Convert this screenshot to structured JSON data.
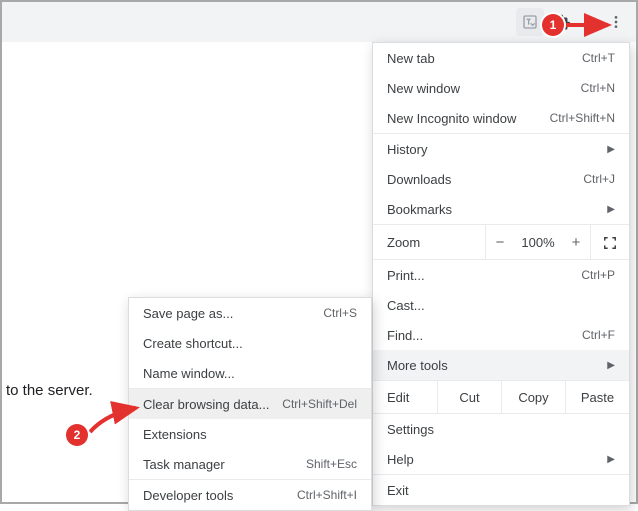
{
  "page_fragment": "to the server.",
  "main_menu": {
    "new_tab": {
      "label": "New tab",
      "shortcut": "Ctrl+T"
    },
    "new_window": {
      "label": "New window",
      "shortcut": "Ctrl+N"
    },
    "new_incognito": {
      "label": "New Incognito window",
      "shortcut": "Ctrl+Shift+N"
    },
    "history": {
      "label": "History"
    },
    "downloads": {
      "label": "Downloads",
      "shortcut": "Ctrl+J"
    },
    "bookmarks": {
      "label": "Bookmarks"
    },
    "zoom": {
      "label": "Zoom",
      "minus": "−",
      "pct": "100%",
      "plus": "+"
    },
    "print": {
      "label": "Print...",
      "shortcut": "Ctrl+P"
    },
    "cast": {
      "label": "Cast..."
    },
    "find": {
      "label": "Find...",
      "shortcut": "Ctrl+F"
    },
    "more_tools": {
      "label": "More tools"
    },
    "edit": {
      "label": "Edit",
      "cut": "Cut",
      "copy": "Copy",
      "paste": "Paste"
    },
    "settings": {
      "label": "Settings"
    },
    "help": {
      "label": "Help"
    },
    "exit": {
      "label": "Exit"
    }
  },
  "sub_menu": {
    "save_page": {
      "label": "Save page as...",
      "shortcut": "Ctrl+S"
    },
    "create_shortcut": {
      "label": "Create shortcut..."
    },
    "name_window": {
      "label": "Name window..."
    },
    "clear_data": {
      "label": "Clear browsing data...",
      "shortcut": "Ctrl+Shift+Del"
    },
    "extensions": {
      "label": "Extensions"
    },
    "task_manager": {
      "label": "Task manager",
      "shortcut": "Shift+Esc"
    },
    "dev_tools": {
      "label": "Developer tools",
      "shortcut": "Ctrl+Shift+I"
    }
  },
  "annotations": {
    "one": "1",
    "two": "2"
  }
}
